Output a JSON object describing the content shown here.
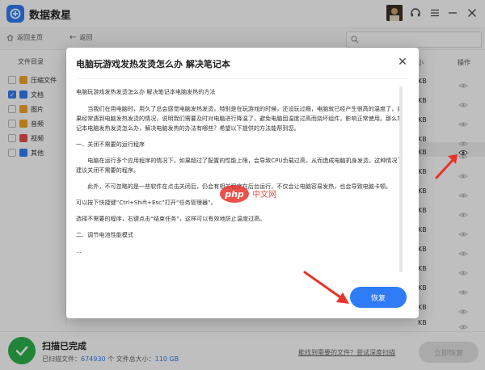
{
  "app": {
    "title": "数据救星"
  },
  "toolbar": {
    "home_label": "返回主页",
    "back_label": "返回"
  },
  "sidebar": {
    "header": "文件目录",
    "items": [
      {
        "label": "压缩文件",
        "checked": false,
        "color": "#f5a623"
      },
      {
        "label": "文档",
        "checked": true,
        "color": "#2f7cf6"
      },
      {
        "label": "图片",
        "checked": false,
        "color": "#f5a623"
      },
      {
        "label": "音频",
        "checked": false,
        "color": "#f5a623"
      },
      {
        "label": "视频",
        "checked": false,
        "color": "#e94f4f"
      },
      {
        "label": "其他",
        "checked": false,
        "color": "#2f7cf6"
      }
    ]
  },
  "list": {
    "col_size_fragment": "小",
    "col_action": "操作",
    "size_cells": [
      "KB",
      "KB",
      "KB",
      "KB",
      "KB",
      "KB",
      "KB",
      "KB",
      "KB",
      "KB",
      "KB",
      "KB",
      "KB",
      "KB",
      "KB"
    ]
  },
  "modal": {
    "title": "电脑玩游戏发热发烫怎么办 解决笔记本",
    "paragraphs": [
      "电脑玩游戏发热发烫怎么办 解决笔记本电脑发热的方法",
      "当我们在用电脑时，用久了总会感觉电脑发热发烫，特别是在玩游戏的时候，还设玩过瘾，电脑就已经产生很高的温度了，如果经常遇到电脑发热发烫的情况，说明我们需要及时对电脑进行降温了，避免电脑因温度过高而烧坏组件，影响正常使用。那么笔记本电脑发热发烫怎么办，解决电脑发热的办法有哪些？希望以下提供的方法能帮到您。",
      "一、关闭不需要的运行程序",
      "电脑在运行多个应用程序的情况下，如果超过了配置的性能上限，会导致CPU负载过高，从而造成电脑机身发烫，这种情况下建议关闭不需要的程序。",
      "此外，不可忽略的是一些软件在点击关闭后，仍会有相关程序在后台运行，不仅会让电脑容易发热，也会导致电脑卡顿。",
      "可以按下快捷键“Ctrl+Shift+Esc”打开“任务管理器”。",
      "选择不需要的程序，右键点击“结束任务”，这样可以有效地防止温度过高。",
      "二、调节电池性能模式",
      "..."
    ],
    "recover_label": "恢复",
    "watermark_text": "php 中文网"
  },
  "footer": {
    "status": "扫描已完成",
    "stats_prefix": "已扫描文件：",
    "file_count": "674930",
    "stats_mid": " 个 文件总大小：",
    "total_size": "110 GB",
    "link_text": "能找到需要的文件？尝试深度扫描",
    "recover_now_label": "立即恢复"
  },
  "colors": {
    "accent": "#2f7cf6",
    "success": "#2bb24c",
    "arrow": "#e8322b"
  }
}
